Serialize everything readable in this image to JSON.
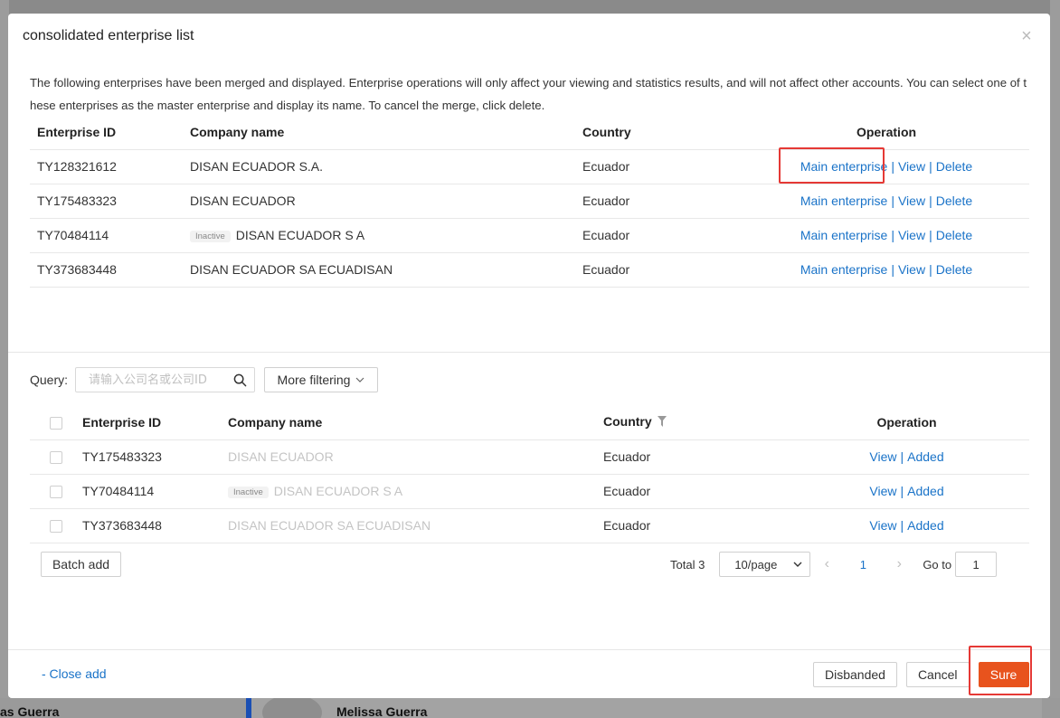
{
  "background": {
    "names": [
      "Melissa Guerra",
      "as Guerra"
    ]
  },
  "modal": {
    "title": "consolidated enterprise list",
    "close_glyph": "×",
    "description": "The following enterprises have been merged and displayed. Enterprise operations will only affect your viewing and statistics results, and will not affect other accounts. You can select one of these enterprises as the master enterprise and display its name. To cancel the merge, click delete."
  },
  "merged_table": {
    "headers": [
      "Enterprise ID",
      "Company name",
      "Country",
      "Operation"
    ],
    "rows": [
      {
        "id": "TY128321612",
        "name": "DISAN ECUADOR S.A.",
        "badge": "",
        "country": "Ecuador"
      },
      {
        "id": "TY175483323",
        "name": "DISAN ECUADOR",
        "badge": "",
        "country": "Ecuador"
      },
      {
        "id": "TY70484114",
        "name": "DISAN ECUADOR S A",
        "badge": "Inactive",
        "country": "Ecuador"
      },
      {
        "id": "TY373683448",
        "name": "DISAN ECUADOR SA ECUADISAN",
        "badge": "",
        "country": "Ecuador"
      }
    ],
    "ops": {
      "main": "Main enterprise",
      "view": "View",
      "delete": "Delete",
      "sep": "|"
    }
  },
  "query": {
    "label": "Query:",
    "placeholder": "请输入公司名或公司ID",
    "more_filtering": "More filtering"
  },
  "candidate_table": {
    "headers": [
      "Enterprise ID",
      "Company name",
      "Country",
      "Operation"
    ],
    "rows": [
      {
        "id": "TY175483323",
        "name": "DISAN ECUADOR",
        "badge": "",
        "country": "Ecuador"
      },
      {
        "id": "TY70484114",
        "name": "DISAN ECUADOR S A",
        "badge": "Inactive",
        "country": "Ecuador"
      },
      {
        "id": "TY373683448",
        "name": "DISAN ECUADOR SA ECUADISAN",
        "badge": "",
        "country": "Ecuador"
      }
    ],
    "ops": {
      "view": "View",
      "added": "Added",
      "sep": "|"
    }
  },
  "batch_add": "Batch add",
  "pagination": {
    "total": "Total 3",
    "page_size": "10/page",
    "current_page": "1",
    "goto_label": "Go to",
    "goto_value": "1"
  },
  "footer": {
    "close_add": "- Close add",
    "disbanded": "Disbanded",
    "cancel": "Cancel",
    "sure": "Sure"
  },
  "colors": {
    "link": "#1a73c8",
    "primary": "#e8531d",
    "highlight": "#e53935"
  }
}
